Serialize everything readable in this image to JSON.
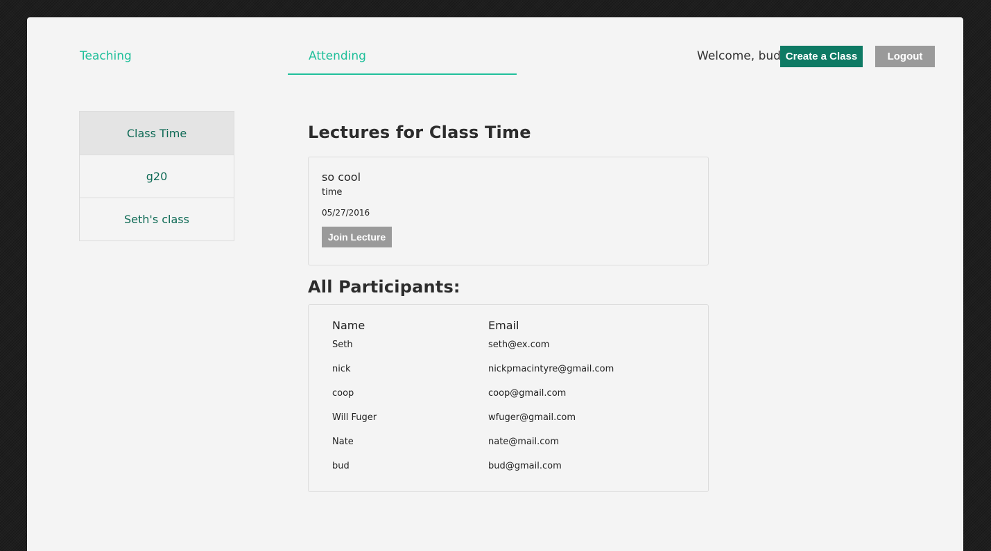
{
  "nav": {
    "teaching": "Teaching",
    "attending": "Attending",
    "welcome": "Welcome, bud",
    "create_class": "Create a Class",
    "logout": "Logout"
  },
  "sidebar": {
    "items": [
      {
        "label": "Class Time"
      },
      {
        "label": "g20"
      },
      {
        "label": "Seth's class"
      }
    ]
  },
  "main": {
    "lectures_heading": "Lectures for Class Time",
    "lecture": {
      "title": "so cool",
      "subtitle": "time",
      "date": "05/27/2016",
      "join_label": "Join Lecture"
    },
    "participants_heading": "All Participants:",
    "participants": {
      "headers": {
        "name": "Name",
        "email": "Email"
      },
      "rows": [
        {
          "name": "Seth",
          "email": "seth@ex.com"
        },
        {
          "name": "nick",
          "email": "nickpmacintyre@gmail.com"
        },
        {
          "name": "coop",
          "email": "coop@gmail.com"
        },
        {
          "name": "Will Fuger",
          "email": "wfuger@gmail.com"
        },
        {
          "name": "Nate",
          "email": "nate@mail.com"
        },
        {
          "name": "bud",
          "email": "bud@gmail.com"
        }
      ]
    }
  },
  "colors": {
    "accent": "#1fbf9a",
    "primary_button": "#0e7a64",
    "secondary_button": "#9a9a9a",
    "sidebar_text": "#0e6a55"
  }
}
